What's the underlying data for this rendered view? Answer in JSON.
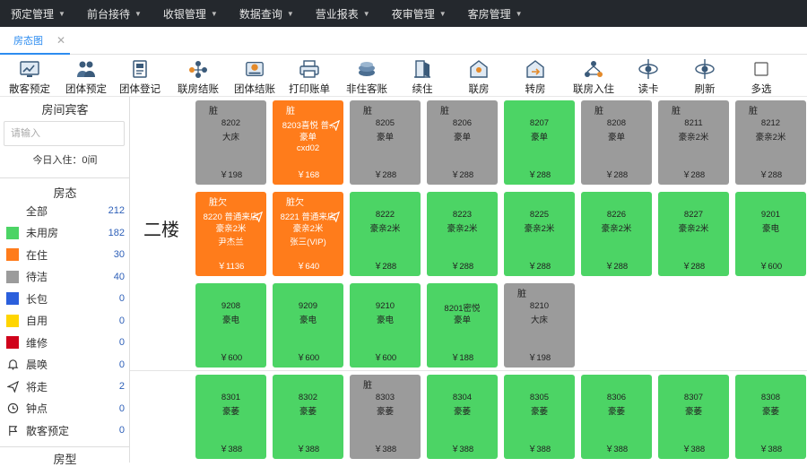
{
  "menu": [
    {
      "label": "预定管理"
    },
    {
      "label": "前台接待"
    },
    {
      "label": "收银管理"
    },
    {
      "label": "数据查询"
    },
    {
      "label": "营业报表"
    },
    {
      "label": "夜审管理"
    },
    {
      "label": "客房管理"
    }
  ],
  "tab": {
    "label": "房态图"
  },
  "toolbar": [
    {
      "label": "散客预定",
      "icon": "reserve-icon"
    },
    {
      "label": "团体预定",
      "icon": "group-icon"
    },
    {
      "label": "团体登记",
      "icon": "register-icon"
    },
    {
      "label": "联房结账",
      "icon": "link-checkout-icon"
    },
    {
      "label": "团体结账",
      "icon": "group-checkout-icon"
    },
    {
      "label": "打印账单",
      "icon": "print-icon"
    },
    {
      "label": "非住客账",
      "icon": "nonguest-icon"
    },
    {
      "label": "续住",
      "icon": "extend-icon"
    },
    {
      "label": "联房",
      "icon": "link-room-icon"
    },
    {
      "label": "转房",
      "icon": "transfer-icon"
    },
    {
      "label": "联房入住",
      "icon": "link-checkin-icon"
    },
    {
      "label": "读卡",
      "icon": "card-icon"
    },
    {
      "label": "刷新",
      "icon": "refresh-icon"
    },
    {
      "label": "多选",
      "icon": "checkbox-icon"
    }
  ],
  "sidebar": {
    "guest_title": "房间宾客",
    "search_placeholder": "请输入",
    "today_checkin": "今日入住：0间",
    "status_title": "房态",
    "statuses": [
      {
        "name": "全部",
        "count": "212",
        "color": "",
        "icon": ""
      },
      {
        "name": "未用房",
        "count": "182",
        "color": "#4cd465",
        "icon": ""
      },
      {
        "name": "在住",
        "count": "30",
        "color": "#ff7c1b",
        "icon": ""
      },
      {
        "name": "待洁",
        "count": "40",
        "color": "#9b9b9b",
        "icon": ""
      },
      {
        "name": "长包",
        "count": "0",
        "color": "#2b5fdc",
        "icon": ""
      },
      {
        "name": "自用",
        "count": "0",
        "color": "#ffd500",
        "icon": ""
      },
      {
        "name": "维修",
        "count": "0",
        "color": "#d0021b",
        "icon": ""
      },
      {
        "name": "晨唤",
        "count": "0",
        "color": "",
        "icon": "bell-icon"
      },
      {
        "name": "将走",
        "count": "2",
        "color": "",
        "icon": "plane-icon"
      },
      {
        "name": "钟点",
        "count": "0",
        "color": "",
        "icon": "clock-icon"
      },
      {
        "name": "散客预定",
        "count": "0",
        "color": "",
        "icon": "flag-icon"
      }
    ],
    "roomtype_title": "房型"
  },
  "floors": [
    {
      "label": "二楼"
    }
  ],
  "colors": {
    "vacant": "#4cd465",
    "occupied": "#ff7c1b",
    "dirty": "#9b9b9b",
    "accent": "#2d8cf0"
  },
  "rooms": [
    {
      "status": "dirty",
      "flag": "脏",
      "l1": "8202",
      "l2": "大床",
      "l3": "",
      "price": "￥198"
    },
    {
      "status": "occupied",
      "flag": "脏",
      "l1": "8203喜悦 普..",
      "l2": "豪单",
      "l3": "cxd02",
      "price": "￥168",
      "plane": true
    },
    {
      "status": "dirty",
      "flag": "脏",
      "l1": "8205",
      "l2": "豪单",
      "l3": "",
      "price": "￥288"
    },
    {
      "status": "dirty",
      "flag": "脏",
      "l1": "8206",
      "l2": "豪单",
      "l3": "",
      "price": "￥288"
    },
    {
      "status": "vacant",
      "flag": "",
      "l1": "8207",
      "l2": "豪单",
      "l3": "",
      "price": "￥288"
    },
    {
      "status": "dirty",
      "flag": "脏",
      "l1": "8208",
      "l2": "豪单",
      "l3": "",
      "price": "￥288"
    },
    {
      "status": "dirty",
      "flag": "脏",
      "l1": "8211",
      "l2": "豪亲2米",
      "l3": "",
      "price": "￥288"
    },
    {
      "status": "dirty",
      "flag": "脏",
      "l1": "8212",
      "l2": "豪亲2米",
      "l3": "",
      "price": "￥288"
    },
    {
      "status": "occupied",
      "flag": "脏欠",
      "l1": "8220 普通来店",
      "l2": "豪亲2米",
      "l3": "尹杰兰",
      "price": "￥1136",
      "plane": true
    },
    {
      "status": "occupied",
      "flag": "脏欠",
      "l1": "8221 普通来店",
      "l2": "豪亲2米",
      "l3": "张三(VIP)",
      "price": "￥640",
      "plane": true
    },
    {
      "status": "vacant",
      "flag": "",
      "l1": "8222",
      "l2": "豪亲2米",
      "l3": "",
      "price": "￥288"
    },
    {
      "status": "vacant",
      "flag": "",
      "l1": "8223",
      "l2": "豪亲2米",
      "l3": "",
      "price": "￥288"
    },
    {
      "status": "vacant",
      "flag": "",
      "l1": "8225",
      "l2": "豪亲2米",
      "l3": "",
      "price": "￥288"
    },
    {
      "status": "vacant",
      "flag": "",
      "l1": "8226",
      "l2": "豪亲2米",
      "l3": "",
      "price": "￥288"
    },
    {
      "status": "vacant",
      "flag": "",
      "l1": "8227",
      "l2": "豪亲2米",
      "l3": "",
      "price": "￥288"
    },
    {
      "status": "vacant",
      "flag": "",
      "l1": "9201",
      "l2": "豪电",
      "l3": "",
      "price": "￥600"
    },
    {
      "status": "vacant",
      "flag": "",
      "l1": "9208",
      "l2": "豪电",
      "l3": "",
      "price": "￥600"
    },
    {
      "status": "vacant",
      "flag": "",
      "l1": "9209",
      "l2": "豪电",
      "l3": "",
      "price": "￥600"
    },
    {
      "status": "vacant",
      "flag": "",
      "l1": "9210",
      "l2": "豪电",
      "l3": "",
      "price": "￥600"
    },
    {
      "status": "vacant",
      "flag": "",
      "l1": "8201密悦",
      "l2": "豪单",
      "l3": "",
      "price": "￥188"
    },
    {
      "status": "dirty",
      "flag": "脏",
      "l1": "8210",
      "l2": "大床",
      "l3": "",
      "price": "￥198"
    },
    {
      "status": "vacant",
      "flag": "",
      "l1": "8301",
      "l2": "豪萎",
      "l3": "",
      "price": "￥388"
    },
    {
      "status": "vacant",
      "flag": "",
      "l1": "8302",
      "l2": "豪萎",
      "l3": "",
      "price": "￥388"
    },
    {
      "status": "dirty",
      "flag": "脏",
      "l1": "8303",
      "l2": "豪萎",
      "l3": "",
      "price": "￥388"
    },
    {
      "status": "vacant",
      "flag": "",
      "l1": "8304",
      "l2": "豪萎",
      "l3": "",
      "price": "￥388"
    },
    {
      "status": "vacant",
      "flag": "",
      "l1": "8305",
      "l2": "豪萎",
      "l3": "",
      "price": "￥388"
    },
    {
      "status": "vacant",
      "flag": "",
      "l1": "8306",
      "l2": "豪萎",
      "l3": "",
      "price": "￥388"
    },
    {
      "status": "vacant",
      "flag": "",
      "l1": "8307",
      "l2": "豪萎",
      "l3": "",
      "price": "￥388"
    },
    {
      "status": "vacant",
      "flag": "",
      "l1": "8308",
      "l2": "豪萎",
      "l3": "",
      "price": "￥388"
    }
  ]
}
